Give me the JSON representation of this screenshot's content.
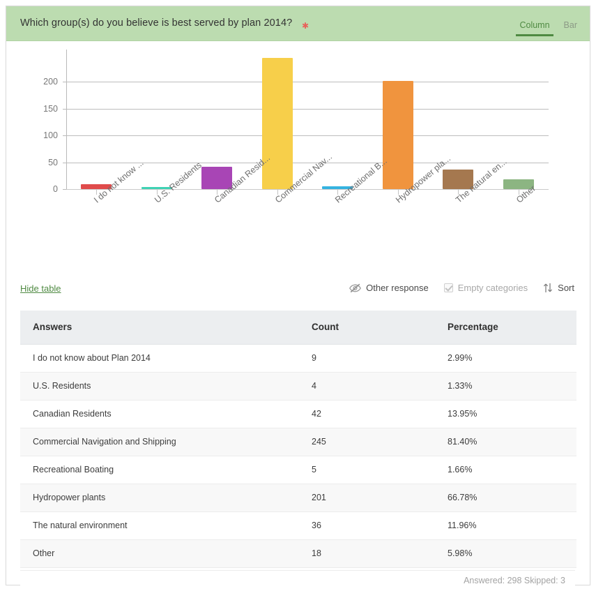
{
  "header": {
    "question": "Which group(s) do you believe is best served by plan 2014?",
    "required_marker": "★",
    "tabs": [
      {
        "label": "Column",
        "active": true
      },
      {
        "label": "Bar",
        "active": false
      }
    ],
    "bg_color": "#bcdcb0",
    "accent_color": "#4f8a42",
    "required_color": "#e8615a"
  },
  "toolbar": {
    "hide_table_label": "Hide table",
    "other_response_label": "Other response",
    "other_response_icon": "eye-slash-icon",
    "empty_categories_label": "Empty categories",
    "empty_categories_checked": true,
    "empty_categories_disabled": true,
    "sort_label": "Sort",
    "sort_icon": "sort-arrows-icon"
  },
  "table": {
    "columns": [
      "Answers",
      "Count",
      "Percentage"
    ],
    "rows": [
      {
        "answer": "I do not know about Plan 2014",
        "count": "9",
        "percentage": "2.99%"
      },
      {
        "answer": "U.S. Residents",
        "count": "4",
        "percentage": "1.33%"
      },
      {
        "answer": "Canadian Residents",
        "count": "42",
        "percentage": "13.95%"
      },
      {
        "answer": "Commercial Navigation and Shipping",
        "count": "245",
        "percentage": "81.40%"
      },
      {
        "answer": "Recreational Boating",
        "count": "5",
        "percentage": "1.66%"
      },
      {
        "answer": "Hydropower plants",
        "count": "201",
        "percentage": "66.78%"
      },
      {
        "answer": "The natural environment",
        "count": "36",
        "percentage": "11.96%"
      },
      {
        "answer": "Other",
        "count": "18",
        "percentage": "5.98%"
      }
    ],
    "footer": "Answered: 298  Skipped: 3"
  },
  "chart_data": {
    "type": "bar",
    "title": "Which group(s) do you believe is best served by plan 2014?",
    "xlabel": "",
    "ylabel": "",
    "ylim": [
      0,
      260
    ],
    "yticks": [
      0,
      50,
      100,
      150,
      200
    ],
    "ytick_labels": [
      "0",
      "50",
      "100",
      "150",
      "200"
    ],
    "grid": true,
    "legend": false,
    "categories": [
      "I do not know about Plan 2014",
      "U.S. Residents",
      "Canadian Residents",
      "Commercial Navigation and Shipping",
      "Recreational Boating",
      "Hydropower plants",
      "The natural environment",
      "Other"
    ],
    "tick_labels": [
      "I do not know ...",
      "U.S. Residents",
      "Canadian Resid...",
      "Commercial Nav...",
      "Recreational B...",
      "Hydropower pla...",
      "The natural en...",
      "Other"
    ],
    "values": [
      9,
      4,
      42,
      245,
      5,
      201,
      36,
      18
    ],
    "colors": [
      "#e04b4b",
      "#3fd2b4",
      "#a845b5",
      "#f7cf4a",
      "#35b3e0",
      "#f0943e",
      "#a5784f",
      "#8cb582"
    ]
  }
}
